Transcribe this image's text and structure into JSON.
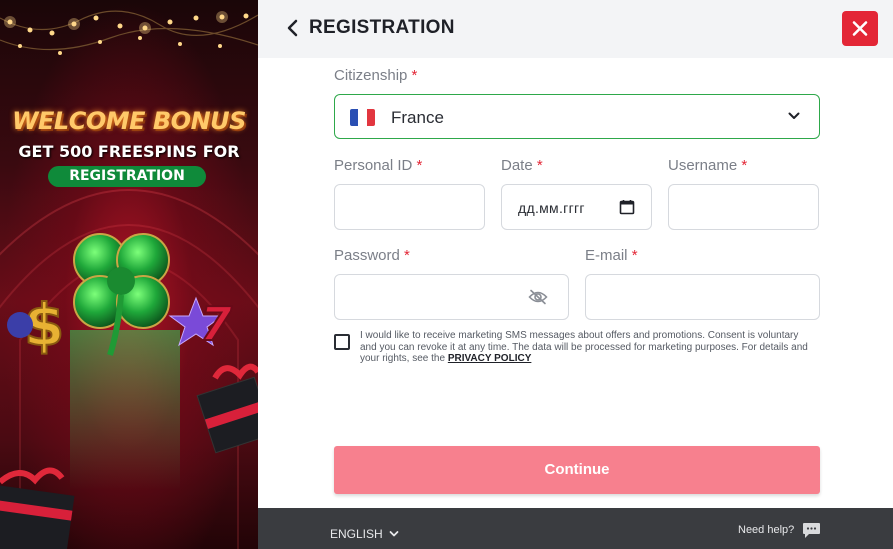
{
  "promo": {
    "headline": "WELCOME BONUS",
    "subline": "GET 500 FREESPINS FOR",
    "badge": "REGISTRATION"
  },
  "header": {
    "title": "REGISTRATION",
    "back_icon": "chevron-left-icon",
    "close_icon": "close-icon"
  },
  "form": {
    "citizenship": {
      "label": "Citizenship",
      "required_mark": "*",
      "value": "France",
      "flag": "france-flag-icon"
    },
    "personal_id": {
      "label": "Personal ID",
      "required_mark": "*",
      "value": ""
    },
    "date": {
      "label": "Date",
      "required_mark": "*",
      "placeholder": "дд.мм.гггг"
    },
    "username": {
      "label": "Username",
      "required_mark": "*",
      "value": ""
    },
    "password": {
      "label": "Password",
      "required_mark": "*",
      "value": ""
    },
    "email": {
      "label": "E-mail",
      "required_mark": "*",
      "value": ""
    },
    "consent": {
      "checked": false,
      "text": "I would like to receive marketing SMS messages about offers and promotions. Consent is voluntary and you can revoke it at any time. The data will be processed for marketing purposes. For details and your rights, see the ",
      "link": "PRIVACY POLICY"
    },
    "continue_label": "Continue"
  },
  "footer": {
    "language": "ENGLISH",
    "help": "Need help?"
  },
  "colors": {
    "accent_red": "#e32636",
    "continue_bg": "#f7808e",
    "active_border": "#2ea84a",
    "footer_bg": "#3a3c40",
    "header_bg": "#f3f4f6"
  }
}
